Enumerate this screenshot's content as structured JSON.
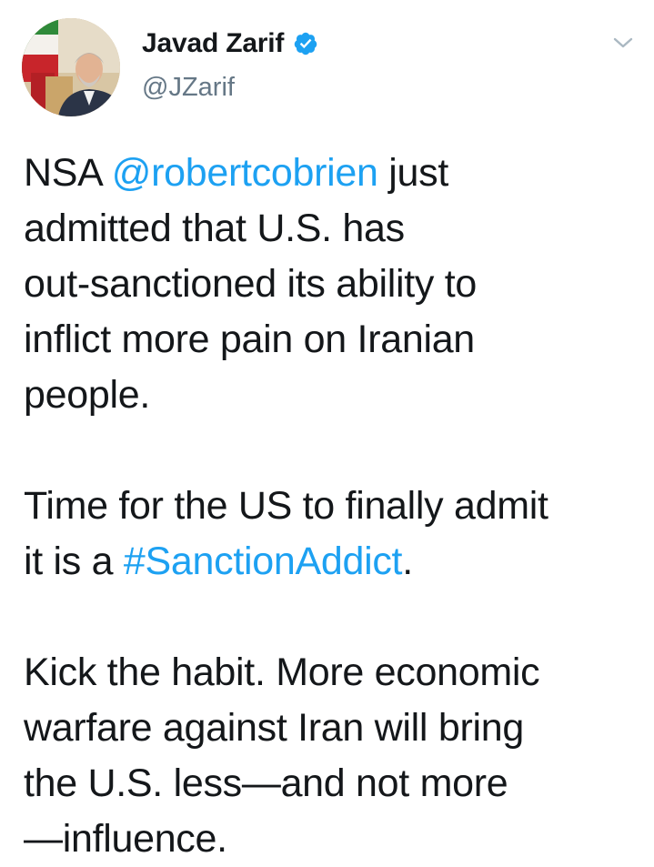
{
  "author": {
    "display_name": "Javad Zarif",
    "handle": "@JZarif",
    "verified_icon": "verified-badge-icon",
    "avatar_icon": "profile-photo",
    "menu_icon": "chevron-down-icon"
  },
  "tweet": {
    "p1": {
      "t1": "NSA ",
      "mention": "@robertcobrien",
      "t2": " just",
      "line2": "admitted that U.S. has",
      "line3": "out-sanctioned its ability to",
      "line4": "inflict more pain on Iranian",
      "line5": "people."
    },
    "p2": {
      "line1": "Time for the US to finally admit",
      "t1": "it is a ",
      "hashtag": "#SanctionAddict",
      "t2": "."
    },
    "p3": {
      "line1": "Kick the habit. More economic",
      "line2": "warfare against Iran will bring",
      "line3": "the U.S. less—and not more",
      "line4": "—influence."
    }
  },
  "colors": {
    "link": "#1da1f2",
    "text": "#14171a",
    "secondary": "#657786",
    "background": "#ffffff"
  }
}
